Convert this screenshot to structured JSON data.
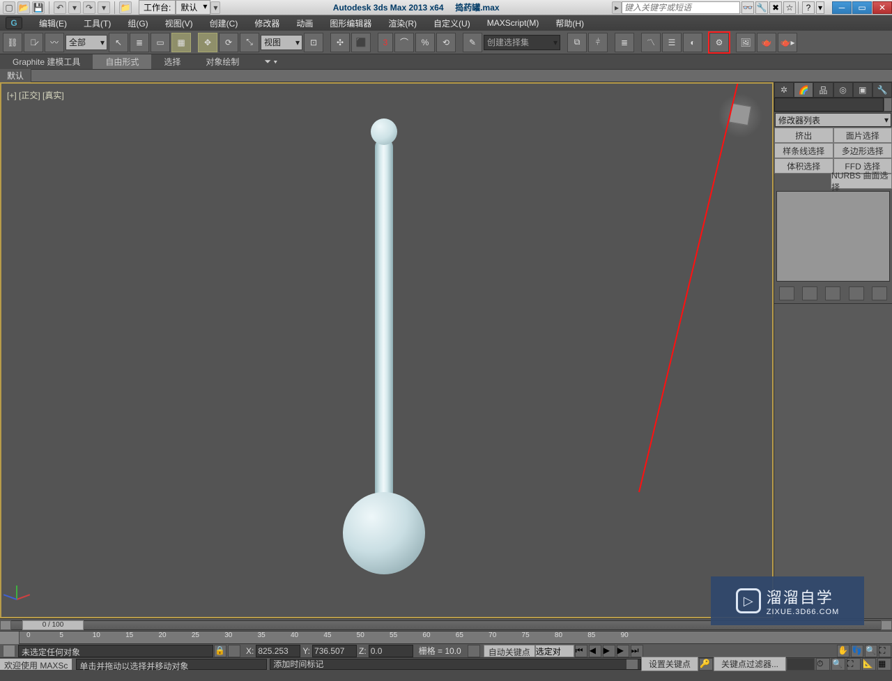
{
  "app": {
    "title_left": "Autodesk 3ds Max  2013 x64",
    "title_file": "捣药罐.max",
    "workspace_label": "工作台:",
    "workspace_value": "默认",
    "search_placeholder": "键入关键字或短语"
  },
  "menu": {
    "items": [
      "编辑(E)",
      "工具(T)",
      "组(G)",
      "视图(V)",
      "创建(C)",
      "修改器",
      "动画",
      "图形编辑器",
      "渲染(R)",
      "自定义(U)",
      "MAXScript(M)",
      "帮助(H)"
    ]
  },
  "toolbar": {
    "selection_filter": "全部",
    "view_dd": "视图",
    "selset_placeholder": "创建选择集"
  },
  "ribbon": {
    "tabs": [
      "Graphite 建模工具",
      "自由形式",
      "选择",
      "对象绘制"
    ],
    "active": 1,
    "sublabel": "默认"
  },
  "viewport": {
    "label": "[+] [正交] [真实]"
  },
  "cmd": {
    "modifier_list": "修改器列表",
    "buttons": [
      "挤出",
      "面片选择",
      "样条线选择",
      "多边形选择",
      "体积选择",
      "FFD 选择"
    ],
    "nurbs": "NURBS 曲面选择"
  },
  "timeline": {
    "slider": "0 / 100",
    "ticks": [
      0,
      5,
      10,
      15,
      20,
      25,
      30,
      35,
      40,
      45,
      50,
      55,
      60,
      65,
      70,
      75,
      80,
      85,
      90
    ]
  },
  "status": {
    "prompt": "未选定任何对象",
    "prompt2": "单击并拖动以选择并移动对象",
    "welcome": "欢迎使用  MAXSc",
    "timetag": "添加时间标记",
    "x": "825.253",
    "y": "736.507",
    "z": "0.0",
    "grid": "栅格 = 10.0",
    "autokey": "自动关键点",
    "setkey": "设置关键点",
    "keyfilters": "关键点过滤器...",
    "sel_locked": "选定对"
  },
  "watermark": {
    "zh": "溜溜自学",
    "url": "ZIXUE.3D66.COM"
  }
}
